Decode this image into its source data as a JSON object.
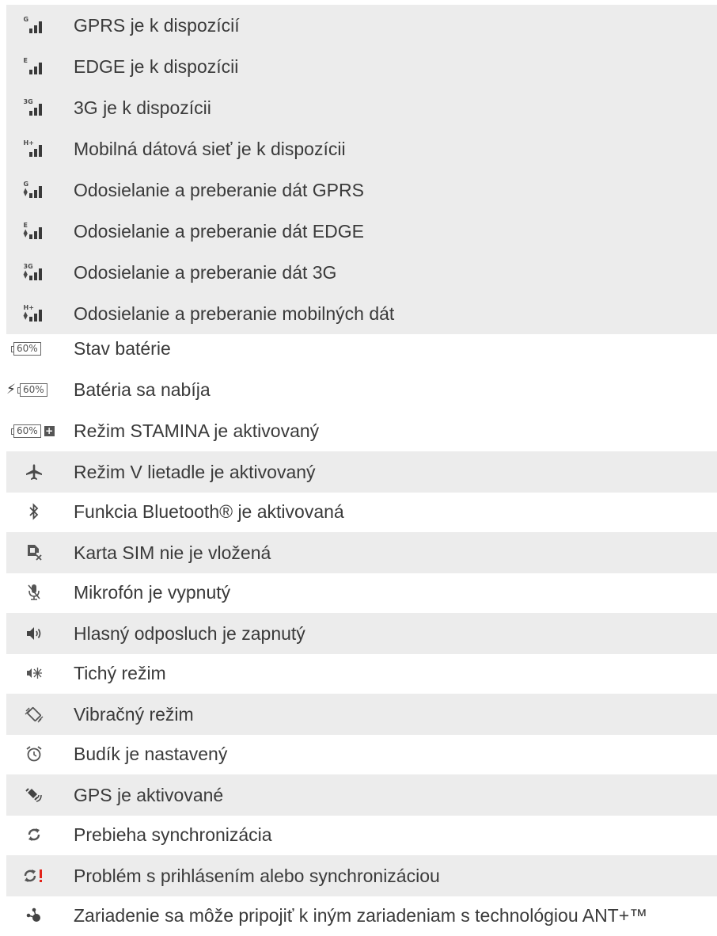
{
  "rows": [
    {
      "icon": "signal-gprs-icon",
      "tag": "G",
      "label": "GPRS je k dispozícií"
    },
    {
      "icon": "signal-edge-icon",
      "tag": "E",
      "label": "EDGE je k dispozícii"
    },
    {
      "icon": "signal-3g-icon",
      "tag": "3G",
      "label": "3G je k dispozícii"
    },
    {
      "icon": "signal-hplus-icon",
      "tag": "H+",
      "label": "Mobilná dátová sieť je k dispozícii"
    },
    {
      "icon": "signal-gprs-transfer-icon",
      "tag": "G",
      "label": "Odosielanie a preberanie dát GPRS"
    },
    {
      "icon": "signal-edge-transfer-icon",
      "tag": "E",
      "label": "Odosielanie a preberanie dát EDGE"
    },
    {
      "icon": "signal-3g-transfer-icon",
      "tag": "3G",
      "label": "Odosielanie a preberanie dát 3G"
    },
    {
      "icon": "signal-hplus-transfer-icon",
      "tag": "H+",
      "label": "Odosielanie a preberanie mobilných dát"
    },
    {
      "icon": "battery-icon",
      "battery_text": "60%",
      "label": "Stav batérie"
    },
    {
      "icon": "battery-charging-icon",
      "battery_text": "60%",
      "label": "Batéria sa nabíja"
    },
    {
      "icon": "battery-stamina-icon",
      "battery_text": "60%",
      "label": "Režim STAMINA je aktivovaný"
    },
    {
      "icon": "airplane-icon",
      "label": "Režim V lietadle je aktivovaný"
    },
    {
      "icon": "bluetooth-icon",
      "label": "Funkcia Bluetooth® je aktivovaná"
    },
    {
      "icon": "no-sim-icon",
      "label": "Karta SIM nie je vložená"
    },
    {
      "icon": "microphone-muted-icon",
      "label": "Mikrofón je vypnutý"
    },
    {
      "icon": "speaker-icon",
      "label": "Hlasný odposluch je zapnutý"
    },
    {
      "icon": "silent-mode-icon",
      "label": "Tichý režim"
    },
    {
      "icon": "vibrate-mode-icon",
      "label": "Vibračný režim"
    },
    {
      "icon": "alarm-clock-icon",
      "label": "Budík je nastavený"
    },
    {
      "icon": "gps-icon",
      "label": "GPS je aktivované"
    },
    {
      "icon": "sync-icon",
      "label": "Prebieha synchronizácia"
    },
    {
      "icon": "sync-error-icon",
      "label": "Problém s prihlásením alebo synchronizáciou"
    },
    {
      "icon": "ant-plus-icon",
      "label": "Zariadenie sa môže pripojiť k iným zariadeniam s technológiou ANT+™"
    }
  ],
  "colors": {
    "shade": "#ececec",
    "text": "#3a3a3a",
    "error": "#e2231a"
  }
}
